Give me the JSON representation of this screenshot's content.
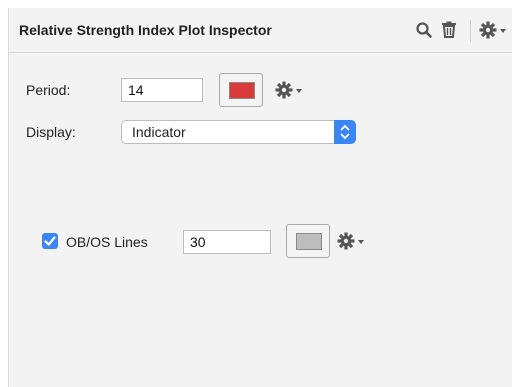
{
  "header": {
    "title": "Relative Strength Index Plot Inspector",
    "icons": [
      "search-icon",
      "trash-icon",
      "gear-icon",
      "chevron-down-icon"
    ]
  },
  "period": {
    "label": "Period:",
    "value": "14",
    "color": "#d93a3a"
  },
  "display": {
    "label": "Display:",
    "selected": "Indicator"
  },
  "obos": {
    "label": "OB/OS Lines",
    "checked": true,
    "value": "30",
    "color": "#bdbdbd"
  },
  "colors": {
    "accent": "#3b86f5",
    "panel_bg": "#f3f3f3"
  }
}
